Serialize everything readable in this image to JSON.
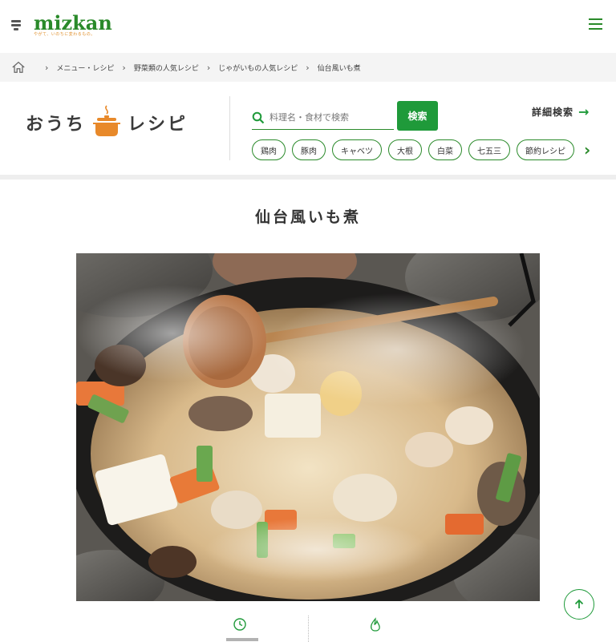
{
  "header": {
    "logo_text": "mizkan",
    "logo_subtext": "やがて、いのちに変わるもの。",
    "menu_icon": "hamburger-icon",
    "brand_color": "#2a8a2a"
  },
  "breadcrumb": {
    "home_icon": "home-icon",
    "items": [
      "メニュー・レシピ",
      "野菜類の人気レシピ",
      "じゃがいもの人気レシピ",
      "仙台風いも煮"
    ]
  },
  "recipe_site": {
    "logo_left": "おうち",
    "logo_right": "レシピ",
    "logo_icon": "pot-icon",
    "search_placeholder": "料理名・食材で検索",
    "search_button": "検索",
    "advanced_search": "詳細検索",
    "advanced_arrow": "→",
    "tags": [
      "鶏肉",
      "豚肉",
      "キャベツ",
      "大根",
      "白菜",
      "七五三",
      "節約レシピ"
    ],
    "tags_next": "›",
    "accent_color": "#1f9a3a"
  },
  "page": {
    "title": "仙台風いも煮"
  },
  "info": {
    "time_icon": "clock-icon",
    "calorie_icon": "flame-icon"
  },
  "scroll_top_icon": "arrow-up-icon"
}
